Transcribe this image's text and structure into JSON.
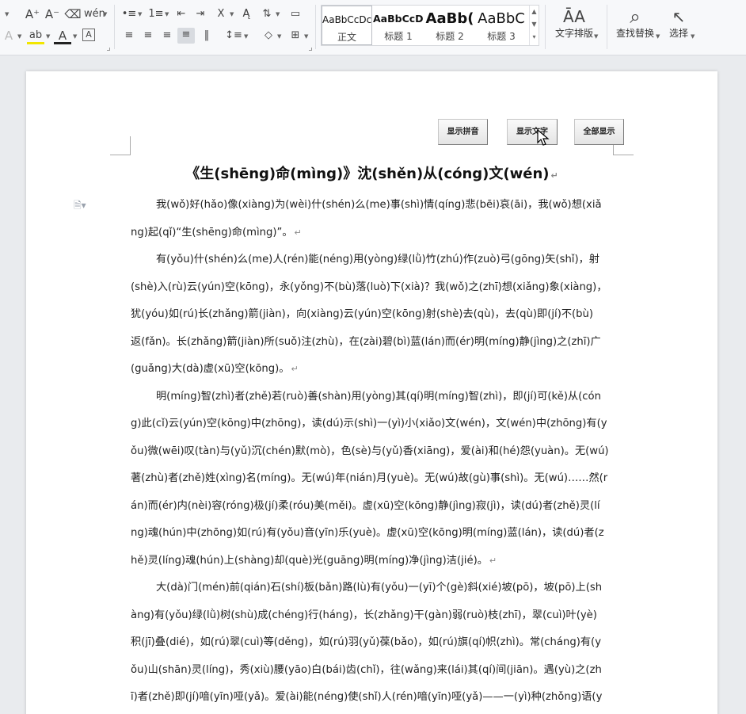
{
  "ribbon": {
    "font_tools": {
      "grow": "A⁺",
      "shrink": "A⁻",
      "clear": "⌫",
      "phonetic": "wén",
      "effects": "A",
      "highlight": "ab",
      "font_color": "A",
      "char_border": "A"
    },
    "para_tools": {
      "bullets": "•≡",
      "numbering": "1≡",
      "outdent": "⇤",
      "indent": "⇥",
      "char_scale": "X",
      "direction": "Ą",
      "sort": "⇅",
      "spacing": "▭",
      "align_left": "≡",
      "align_center": "≡",
      "align_right": "≡",
      "justify": "≡",
      "distribute": "‖",
      "line_spacing": "↕≡",
      "shading": "◇",
      "borders": "⊞"
    },
    "styles": [
      {
        "preview": "AaBbCcDc",
        "name": "正文",
        "selected": true
      },
      {
        "preview": "AaBbCcDd",
        "name": "标题 1",
        "selected": false
      },
      {
        "preview": "AaBb(",
        "name": "标题 2",
        "selected": false
      },
      {
        "preview": "AaBbC",
        "name": "标题 3",
        "selected": false
      }
    ],
    "text_layout": {
      "icon": "ĀA",
      "label": "文字排版"
    },
    "find_replace": {
      "icon": "⌕",
      "label": "查找替换"
    },
    "select": {
      "icon": "↖",
      "label": "选择"
    }
  },
  "doc_buttons": {
    "show_pinyin": "显示拼音",
    "show_text": "显示文字",
    "show_all": "全部显示"
  },
  "title": "《生(shēng)命(mìng)》沈(shěn)从(cóng)文(wén)",
  "lines": [
    {
      "text": "我(wǒ)好(hǎo)像(xiàng)为(wèi)什(shén)么(me)事(shì)情(qíng)悲(bēi)哀(āi)，我(wǒ)想(xiǎ",
      "indent": true,
      "mark": false
    },
    {
      "text": "ng)起(qǐ)“生(shēng)命(mìng)”。",
      "indent": false,
      "mark": true
    },
    {
      "text": "有(yǒu)什(shén)么(me)人(rén)能(néng)用(yòng)绿(lǜ)竹(zhú)作(zuò)弓(gōng)矢(shǐ)，射",
      "indent": true,
      "mark": false
    },
    {
      "text": "(shè)入(rù)云(yún)空(kōng)，永(yǒng)不(bù)落(luò)下(xià)？我(wǒ)之(zhī)想(xiǎng)象(xiàng)，",
      "indent": false,
      "mark": false
    },
    {
      "text": "犹(yóu)如(rú)长(zhǎng)箭(jiàn)，向(xiàng)云(yún)空(kōng)射(shè)去(qù)，去(qù)即(jí)不(bù)",
      "indent": false,
      "mark": false
    },
    {
      "text": "返(fǎn)。长(zhǎng)箭(jiàn)所(suǒ)注(zhù)，在(zài)碧(bì)蓝(lán)而(ér)明(míng)静(jìng)之(zhī)广",
      "indent": false,
      "mark": false
    },
    {
      "text": "(guǎng)大(dà)虚(xū)空(kōng)。",
      "indent": false,
      "mark": true
    },
    {
      "text": "明(míng)智(zhì)者(zhě)若(ruò)善(shàn)用(yòng)其(qí)明(míng)智(zhì)，即(jí)可(kě)从(cón",
      "indent": true,
      "mark": false
    },
    {
      "text": "g)此(cǐ)云(yún)空(kōng)中(zhōng)，读(dú)示(shì)一(yì)小(xiǎo)文(wén)，文(wén)中(zhōng)有(y",
      "indent": false,
      "mark": false
    },
    {
      "text": "ǒu)微(wēi)叹(tàn)与(yǔ)沉(chén)默(mò)，色(sè)与(yǔ)香(xiāng)，爱(ài)和(hé)怨(yuàn)。无(wú)",
      "indent": false,
      "mark": false
    },
    {
      "text": "著(zhù)者(zhě)姓(xìng)名(míng)。无(wú)年(nián)月(yuè)。无(wú)故(gù)事(shì)。无(wú)……然(r",
      "indent": false,
      "mark": false
    },
    {
      "text": "án)而(ér)内(nèi)容(róng)极(jí)柔(róu)美(měi)。虚(xū)空(kōng)静(jìng)寂(jì)，读(dú)者(zhě)灵(lí",
      "indent": false,
      "mark": false
    },
    {
      "text": "ng)魂(hún)中(zhōng)如(rú)有(yǒu)音(yīn)乐(yuè)。虚(xū)空(kōng)明(míng)蓝(lán)，读(dú)者(z",
      "indent": false,
      "mark": false
    },
    {
      "text": "hě)灵(líng)魂(hún)上(shàng)却(què)光(guāng)明(míng)净(jìng)洁(jié)。",
      "indent": false,
      "mark": true
    },
    {
      "text": "大(dà)门(mén)前(qián)石(shí)板(bǎn)路(lù)有(yǒu)一(yī)个(gè)斜(xié)坡(pō)，坡(pō)上(sh",
      "indent": true,
      "mark": false
    },
    {
      "text": "àng)有(yǒu)绿(lǜ)树(shù)成(chéng)行(háng)，长(zhǎng)干(gàn)弱(ruò)枝(zhī)，翠(cuì)叶(yè)",
      "indent": false,
      "mark": false
    },
    {
      "text": "积(jī)叠(dié)，如(rú)翠(cuì)等(děng)，如(rú)羽(yǔ)葆(bǎo)，如(rú)旗(qí)帜(zhì)。常(cháng)有(y",
      "indent": false,
      "mark": false
    },
    {
      "text": "ǒu)山(shān)灵(líng)，秀(xiù)腰(yāo)白(bái)齿(chǐ)，往(wǎng)来(lái)其(qí)间(jiān)。遇(yù)之(zh",
      "indent": false,
      "mark": false
    },
    {
      "text": "ī)者(zhě)即(jí)喑(yīn)哑(yǎ)。爱(ài)能(néng)使(shǐ)人(rén)喑(yīn)哑(yǎ)——一(yì)种(zhǒng)语(y",
      "indent": false,
      "mark": false
    }
  ],
  "para_mark": "↵"
}
